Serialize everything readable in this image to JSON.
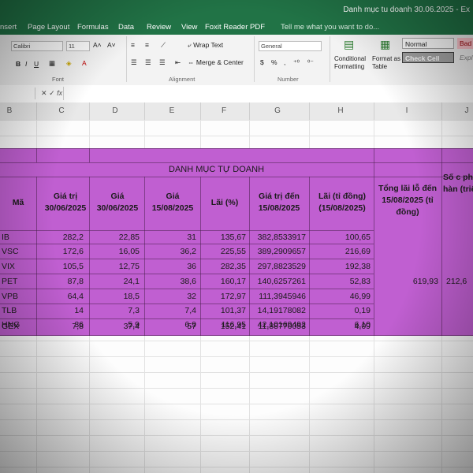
{
  "window": {
    "title": "Danh mục tu doanh 30.06.2025 - Ex"
  },
  "ribbon_tabs": [
    "nsert",
    "Page Layout",
    "Formulas",
    "Data",
    "Review",
    "View",
    "Foxit Reader PDF"
  ],
  "tell_me": "Tell me what you want to do...",
  "ribbon": {
    "font_name": "Calibri",
    "font_size": "11",
    "bold": "B",
    "italic": "I",
    "underline": "U",
    "wrap_text": "Wrap Text",
    "merge_center": "Merge & Center",
    "number_format": "General",
    "percent": "%",
    "comma": ",",
    "conditional_formatting": "Conditional Formatting",
    "format_as_table": "Format as Table",
    "style_normal": "Normal",
    "style_bad": "Bad",
    "style_check_cell": "Check Cell",
    "style_explanatory": "Expl",
    "group_font": "Font",
    "group_alignment": "Alignment",
    "group_number": "Number",
    "fx": "fx"
  },
  "columns": [
    "B",
    "C",
    "D",
    "E",
    "F",
    "G",
    "H",
    "I",
    "J"
  ],
  "table": {
    "title": "DANH MỤC TỰ DOANH",
    "headers": {
      "ma": "Mã",
      "gia_tri": "Giá trị 30/06/2025",
      "gia_3006": "Giá 30/06/2025",
      "gia_1508": "Giá 15/08/2025",
      "lai_pct": "Lãi (%)",
      "gia_tri_den": "Giá trị đến 15/08/2025",
      "lai_ty": "Lãi (tỉ đồng) (15/08/2025)",
      "tong_lai": "Tổng lãi lỗ đến 15/08/2025 (tỉ đồng)",
      "so_cp": "Số c phiếu hàn (triệ"
    },
    "rows": [
      {
        "ma": "IB",
        "gia_tri": "282,2",
        "gia_3006": "22,85",
        "gia_1508": "31",
        "lai_pct": "135,67",
        "gia_tri_den": "382,8533917",
        "lai_ty": "100,65"
      },
      {
        "ma": "VSC",
        "gia_tri": "172,6",
        "gia_3006": "16,05",
        "gia_1508": "36,2",
        "lai_pct": "225,55",
        "gia_tri_den": "389,2909657",
        "lai_ty": "216,69"
      },
      {
        "ma": "VIX",
        "gia_tri": "105,5",
        "gia_3006": "12,75",
        "gia_1508": "36",
        "lai_pct": "282,35",
        "gia_tri_den": "297,8823529",
        "lai_ty": "192,38"
      },
      {
        "ma": "PET",
        "gia_tri": "87,8",
        "gia_3006": "24,1",
        "gia_1508": "38,6",
        "lai_pct": "160,17",
        "gia_tri_den": "140,6257261",
        "lai_ty": "52,83"
      },
      {
        "ma": "VPB",
        "gia_tri": "64,4",
        "gia_3006": "18,5",
        "gia_1508": "32",
        "lai_pct": "172,97",
        "gia_tri_den": "111,3945946",
        "lai_ty": "46,99"
      },
      {
        "ma": "TLB",
        "gia_tri": "14",
        "gia_3006": "7,3",
        "gia_1508": "7,4",
        "lai_pct": "101,37",
        "gia_tri_den": "14,19178082",
        "lai_ty": "0,19"
      },
      {
        "ma": "HNG",
        "gia_tri": "36",
        "gia_3006": "5,9",
        "gia_1508": "6,9",
        "lai_pct": "116,95",
        "gia_tri_den": "42,10169492",
        "lai_ty": "6,10"
      },
      {
        "ma": "GEX",
        "gia_tri": "7,8",
        "gia_3006": "37,4",
        "gia_1508": "57",
        "lai_pct": "152,41",
        "gia_tri_den": "11,88770053",
        "lai_ty": "4,09"
      }
    ],
    "tong_lai_value": "619,93",
    "so_cp_value": "212,6"
  }
}
